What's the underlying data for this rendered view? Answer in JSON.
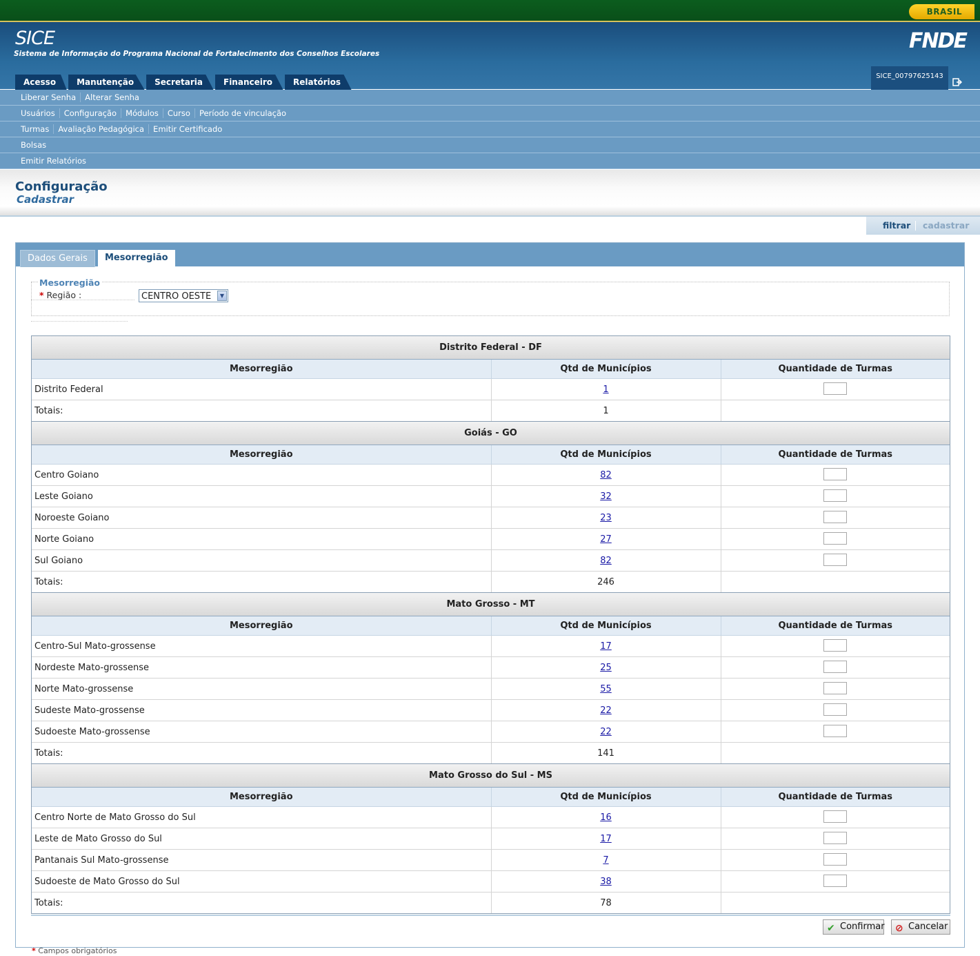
{
  "header": {
    "brasil": "BRASIL",
    "app_name": "SICE",
    "app_subtitle": "Sistema de Informação do Programa Nacional de Fortalecimento dos Conselhos Escolares",
    "agency": "FNDE",
    "user": "SICE_00797625143"
  },
  "main_nav": [
    "Acesso",
    "Manutenção",
    "Secretaria",
    "Financeiro",
    "Relatórios"
  ],
  "submenus": [
    [
      "Liberar Senha",
      "Alterar Senha"
    ],
    [
      "Usuários",
      "Configuração",
      "Módulos",
      "Curso",
      "Período de vinculação"
    ],
    [
      "Turmas",
      "Avaliação Pedagógica",
      "Emitir Certificado"
    ],
    [
      "Bolsas"
    ],
    [
      "Emitir Relatórios"
    ]
  ],
  "page": {
    "title": "Configuração",
    "subtitle": "Cadastrar"
  },
  "actions": {
    "filtrar": "filtrar",
    "cadastrar": "cadastrar"
  },
  "tabs": {
    "dados_gerais": "Dados Gerais",
    "mesorregiao": "Mesorregião"
  },
  "form": {
    "legend": "Mesorregião",
    "required_mark": "*",
    "regiao_label": "Região :",
    "regiao_value": "CENTRO OESTE"
  },
  "columns": {
    "mesorregiao": "Mesorregião",
    "qtd": "Qtd de Municípios",
    "turmas": "Quantidade de Turmas"
  },
  "totais_label": "Totais:",
  "sections": [
    {
      "title": "Distrito Federal - DF",
      "total": "1",
      "rows": [
        {
          "name": "Distrito Federal",
          "qtd": "1"
        }
      ]
    },
    {
      "title": "Goiás - GO",
      "total": "246",
      "rows": [
        {
          "name": "Centro Goiano",
          "qtd": "82"
        },
        {
          "name": "Leste Goiano",
          "qtd": "32"
        },
        {
          "name": "Noroeste Goiano",
          "qtd": "23"
        },
        {
          "name": "Norte Goiano",
          "qtd": "27"
        },
        {
          "name": "Sul Goiano",
          "qtd": "82"
        }
      ]
    },
    {
      "title": "Mato Grosso - MT",
      "total": "141",
      "rows": [
        {
          "name": "Centro-Sul Mato-grossense",
          "qtd": "17"
        },
        {
          "name": "Nordeste Mato-grossense",
          "qtd": "25"
        },
        {
          "name": "Norte Mato-grossense",
          "qtd": "55"
        },
        {
          "name": "Sudeste Mato-grossense",
          "qtd": "22"
        },
        {
          "name": "Sudoeste Mato-grossense",
          "qtd": "22"
        }
      ]
    },
    {
      "title": "Mato Grosso do Sul - MS",
      "total": "78",
      "rows": [
        {
          "name": "Centro Norte de Mato Grosso do Sul",
          "qtd": "16"
        },
        {
          "name": "Leste de Mato Grosso do Sul",
          "qtd": "17"
        },
        {
          "name": "Pantanais Sul Mato-grossense",
          "qtd": "7"
        },
        {
          "name": "Sudoeste de Mato Grosso do Sul",
          "qtd": "38"
        }
      ]
    }
  ],
  "buttons": {
    "confirm": "Confirmar",
    "cancel": "Cancelar"
  },
  "footnote": "Campos obrigatórios",
  "icons": {
    "confirm": "check-icon",
    "cancel": "cancel-icon",
    "logout": "logout-icon"
  }
}
